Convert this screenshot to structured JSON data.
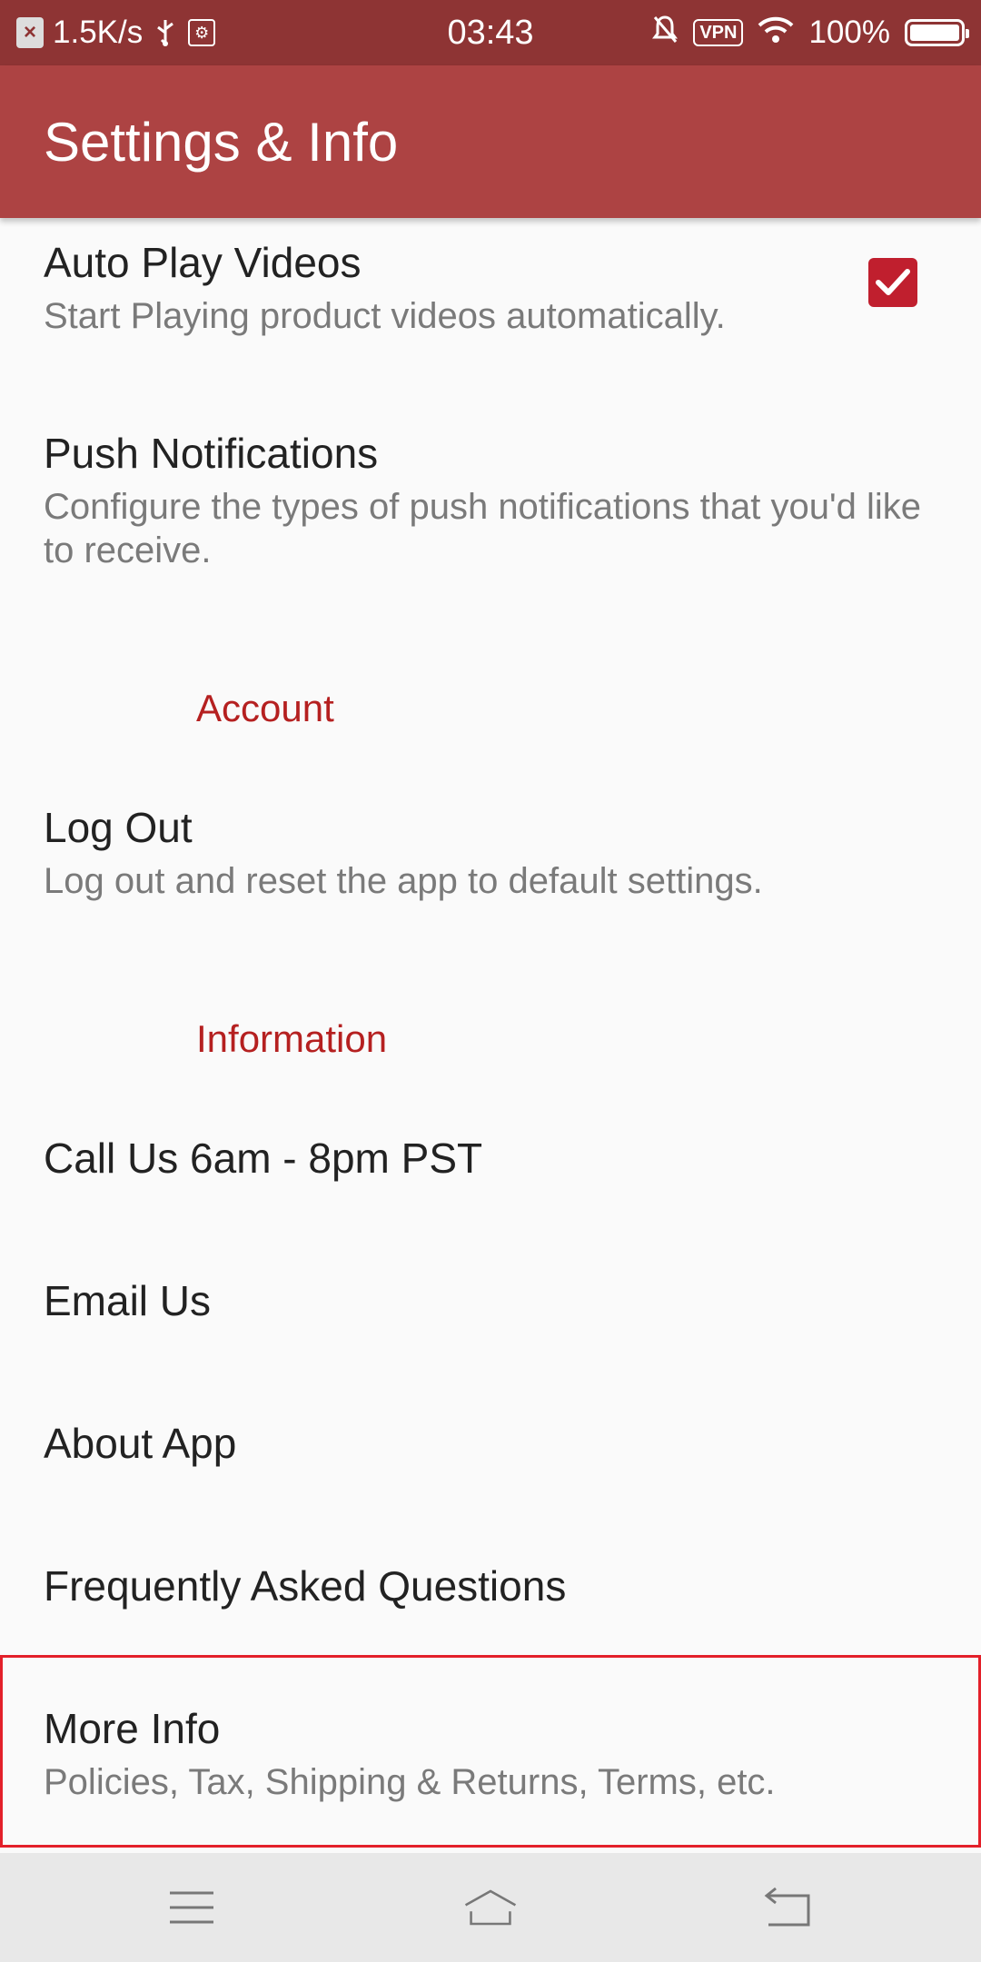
{
  "status_bar": {
    "speed": "1.5K/s",
    "time": "03:43",
    "vpn": "VPN",
    "battery": "100%"
  },
  "app_bar": {
    "title": "Settings & Info"
  },
  "prefs": {
    "auto_play": {
      "title": "Auto Play Videos",
      "summary": "Start Playing product videos automatically.",
      "checked": true
    },
    "push": {
      "title": "Push Notifications",
      "summary": "Configure the types of push notifications that you'd like to receive."
    },
    "account_header": "Account",
    "logout": {
      "title": "Log Out",
      "summary": "Log out and reset the app to default settings."
    },
    "info_header": "Information",
    "call_us": "Call Us 6am - 8pm PST",
    "email_us": "Email Us",
    "about": "About App",
    "faq": "Frequently Asked Questions",
    "more_info": {
      "title": "More Info",
      "summary": "Policies, Tax, Shipping & Returns, Terms, etc."
    }
  },
  "colors": {
    "status_bar": "#8e3434",
    "app_bar": "#ad4343",
    "accent": "#b52020",
    "highlight": "#e3202a"
  },
  "nav_icons": [
    "menu-icon",
    "home-icon",
    "back-icon"
  ]
}
